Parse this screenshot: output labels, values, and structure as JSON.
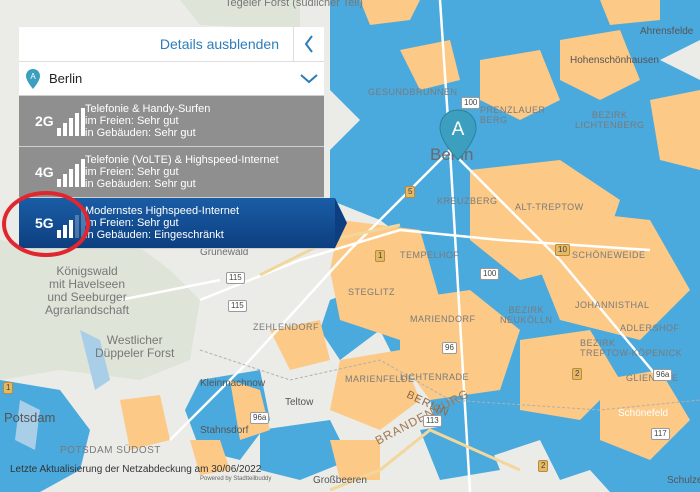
{
  "panel": {
    "header_label": "Details ausblenden",
    "location": "Berlin",
    "networks": [
      {
        "gen": "2G",
        "title": "Telefonie & Handy-Surfen",
        "outdoor": "im Freien: Sehr gut",
        "indoor": "in Gebäuden: Sehr gut",
        "bars": 5,
        "selected": false
      },
      {
        "gen": "4G",
        "title": "Telefonie (VoLTE) & Highspeed-Internet",
        "outdoor": "im Freien: Sehr gut",
        "indoor": "in Gebäuden: Sehr gut",
        "bars": 5,
        "selected": false
      },
      {
        "gen": "5G",
        "title": "Modernstes Highspeed-Internet",
        "outdoor": "im Freien: Sehr gut",
        "indoor": "in Gebäuden: Eingeschränkt",
        "bars": 2,
        "selected": true
      }
    ]
  },
  "map": {
    "pin_label": "A",
    "city_label": "Berlin",
    "places": {
      "tegeler_forst": "Tegeler Forst\n(südlicher Teil)",
      "ahrensfelde": "Ahrensfelde",
      "hohenschoenhausen": "Hohenschönhausen",
      "gesundbrunnen": "GESUNDBRUNNEN",
      "prenzlauer_berg": "PRENZLAUER\nBERG",
      "bezirk_lichtenberg": "BEZIRK\nLICHTENBERG",
      "kreuzberg": "KREUZBERG",
      "alt_treptow": "ALT-TREPTOW",
      "tempelhof": "TEMPELHOF",
      "schoeneweide": "SCHÖNEWEIDE",
      "grunewald": "Grunewald",
      "koenigswald": "Königswald\nmit Havelseen\nund Seeburger\nAgrarlandschaft",
      "steglitz": "STEGLITZ",
      "bezirk_neukoelln": "BEZIRK\nNEUKÖLLN",
      "zehlendorf": "ZEHLENDORF",
      "mariendorf": "MARIENDORF",
      "johannisthal": "JOHANNISTHAL",
      "bezirk_treptow_koepenick": "BEZIRK\nTREPTOW-KÖPENICK",
      "adlershof": "ADLERSHOF",
      "westlicher_dueppeler_forst": "Westlicher\nDüppeler Forst",
      "lichtenrade": "LICHTENRADE",
      "marienfelde": "MARIENFELDE",
      "kleinmachnow": "Kleinmachnow",
      "teltow": "Teltow",
      "gluecksburg": "GLIENICKE",
      "brandenburg": "BRANDENBURG",
      "berlin_border": "BERLIN",
      "potsdam": "Potsdam",
      "potsdam_sued": "POTSDAM SÜDOST",
      "stahnsdorf": "Stahnsdorf",
      "schoenefeld": "Schönefeld",
      "grossbeeren": "Großbeeren",
      "schulzendorf": "Schulze"
    },
    "shields": [
      "115",
      "100",
      "100",
      "113",
      "96",
      "96a",
      "1",
      "5",
      "2",
      "10",
      "117",
      "115",
      "1",
      "96a",
      "2"
    ]
  },
  "footer": {
    "note": "Letzte Aktualisierung der Netzabdeckung am 30/06/2022",
    "powered": "Powered by Stadtteilbuddy"
  },
  "colors": {
    "coverage_blue": "#4aa9dd",
    "coverage_orange": "#fcc986",
    "selected_row": "#1a5da6",
    "grey_row": "#8f8f8f",
    "pin": "#3d9fbf",
    "highlight_circle": "#e0262e"
  }
}
